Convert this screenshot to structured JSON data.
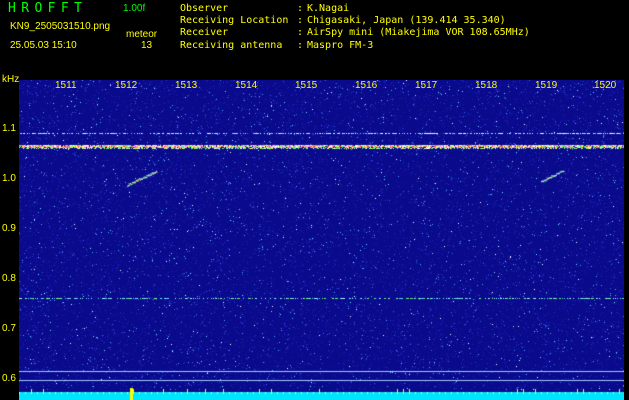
{
  "header": {
    "app_title": "HROFFT",
    "version": "1.00f",
    "filename": "KN9_2505031510.png",
    "meteor_label": "meteor",
    "datetime": "25.05.03 15:10",
    "meteor_count": "13"
  },
  "station": [
    {
      "key": "Observer",
      "value": "K.Nagai"
    },
    {
      "key": "Receiving Location",
      "value": "Chigasaki, Japan (139.414 35.340)"
    },
    {
      "key": "Receiver",
      "value": "AirSpy mini (Miakejima VOR 108.65MHz)"
    },
    {
      "key": "Receiving antenna",
      "value": "Maspro FM-3"
    }
  ],
  "axis": {
    "y_unit": "kHz",
    "y_ticks": [
      "1.1",
      "1.0",
      "0.9",
      "0.8",
      "0.7",
      "0.6"
    ],
    "time_ticks": [
      "1511",
      "1512",
      "1513",
      "1514",
      "1515",
      "1516",
      "1517",
      "1518",
      "1519",
      "1520"
    ]
  },
  "colors": {
    "background": "#000000",
    "spectrogram": "#0a0a8c",
    "label": "#ffff00",
    "title": "#00ff00",
    "baseline": "#00e5ff"
  }
}
